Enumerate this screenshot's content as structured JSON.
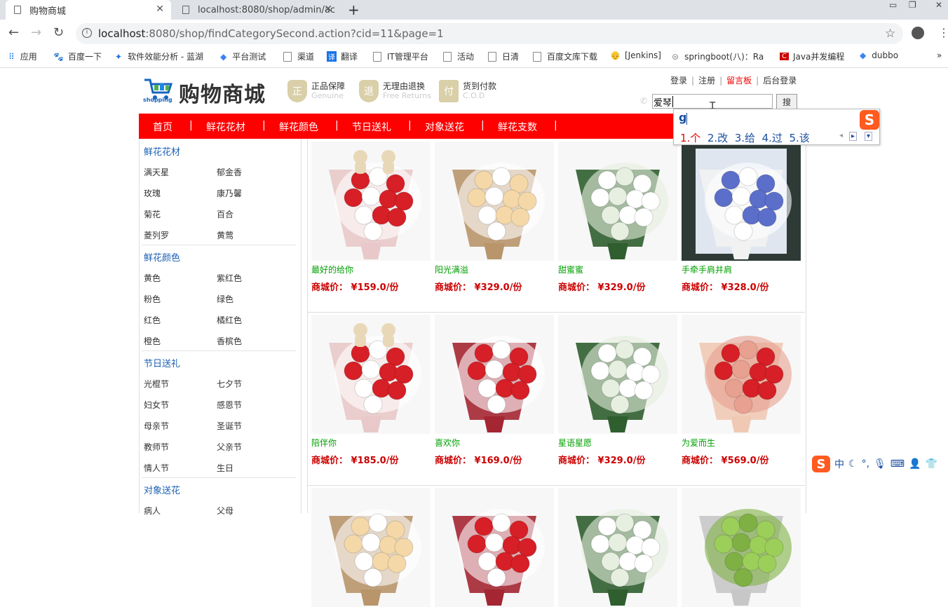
{
  "browser": {
    "tabs": [
      {
        "title": "购物商城",
        "active": true
      },
      {
        "title": "localhost:8080/shop/admin/ac",
        "active": false
      }
    ],
    "url_host": "localhost",
    "url_rest": ":8080/shop/findCategorySecond.action?cid=11&page=1",
    "bookmarks": [
      "应用",
      "百度一下",
      "软件效能分析 - 蓝湖",
      "平台测试",
      "渠道",
      "翻译",
      "IT管理平台",
      "活动",
      "日清",
      "百度文库下载",
      "[Jenkins]",
      "springboot(八)：Ra",
      "Java并发编程",
      "dubbo"
    ]
  },
  "header": {
    "logo_text": "购物商城",
    "logo_sub": "shopping",
    "badges": [
      {
        "icon": "正",
        "title": "正品保障",
        "sub": "Genuine"
      },
      {
        "icon": "退",
        "title": "无理由退换",
        "sub": "Free Returns"
      },
      {
        "icon": "付",
        "title": "货到付款",
        "sub": "C.O.D"
      }
    ],
    "links": [
      "登录",
      "注册",
      "留言板",
      "后台登录"
    ],
    "search_value": "爱琴",
    "search_button": "搜"
  },
  "nav": [
    "首页",
    "鲜花花材",
    "鲜花颜色",
    "节日送礼",
    "对象送花",
    "鲜花支数"
  ],
  "sidebar": [
    {
      "title": "鲜花花材",
      "items": [
        "满天星",
        "郁金香",
        "玫瑰",
        "康乃馨",
        "菊花",
        "百合",
        "菱列罗",
        "黄莺"
      ]
    },
    {
      "title": "鲜花颜色",
      "items": [
        "黄色",
        "紫红色",
        "粉色",
        "绿色",
        "红色",
        "橘红色",
        "橙色",
        "香槟色"
      ]
    },
    {
      "title": "节日送礼",
      "items": [
        "光棍节",
        "七夕节",
        "妇女节",
        "感恩节",
        "母亲节",
        "圣诞节",
        "教师节",
        "父亲节",
        "情人节",
        "生日"
      ]
    },
    {
      "title": "对象送花",
      "items": [
        "病人",
        "父母"
      ]
    }
  ],
  "products": [
    {
      "name": "最好的给你",
      "price": "商城价：  ¥159.0/份",
      "kind": "red-bears"
    },
    {
      "name": "阳光满溢",
      "price": "商城价：  ¥329.0/份",
      "kind": "champagne"
    },
    {
      "name": "甜蜜蜜",
      "price": "商城价：  ¥329.0/份",
      "kind": "white"
    },
    {
      "name": "手牵手肩并肩",
      "price": "商城价：  ¥328.0/份",
      "kind": "blue"
    },
    {
      "name": "陪伴你",
      "price": "商城价：  ¥185.0/份",
      "kind": "red-bears"
    },
    {
      "name": "喜欢你",
      "price": "商城价：  ¥169.0/份",
      "kind": "red-white"
    },
    {
      "name": "星语星愿",
      "price": "商城价：  ¥329.0/份",
      "kind": "white"
    },
    {
      "name": "为爱而生",
      "price": "商城价：  ¥569.0/份",
      "kind": "red-pink"
    },
    {
      "name": "",
      "price": "",
      "kind": "champagne"
    },
    {
      "name": "",
      "price": "",
      "kind": "red-white"
    },
    {
      "name": "",
      "price": "",
      "kind": "white"
    },
    {
      "name": "",
      "price": "",
      "kind": "green"
    }
  ],
  "ime": {
    "input": "g",
    "candidates": [
      "1.个",
      "2.改",
      "3.给",
      "4.过",
      "5.该"
    ],
    "logo": "S",
    "status": "中"
  },
  "colors": {
    "nav_red": "#ff0000",
    "price_red": "#cc0000",
    "name_green": "#00a000",
    "sidebar_blue": "#1a5fb4"
  }
}
